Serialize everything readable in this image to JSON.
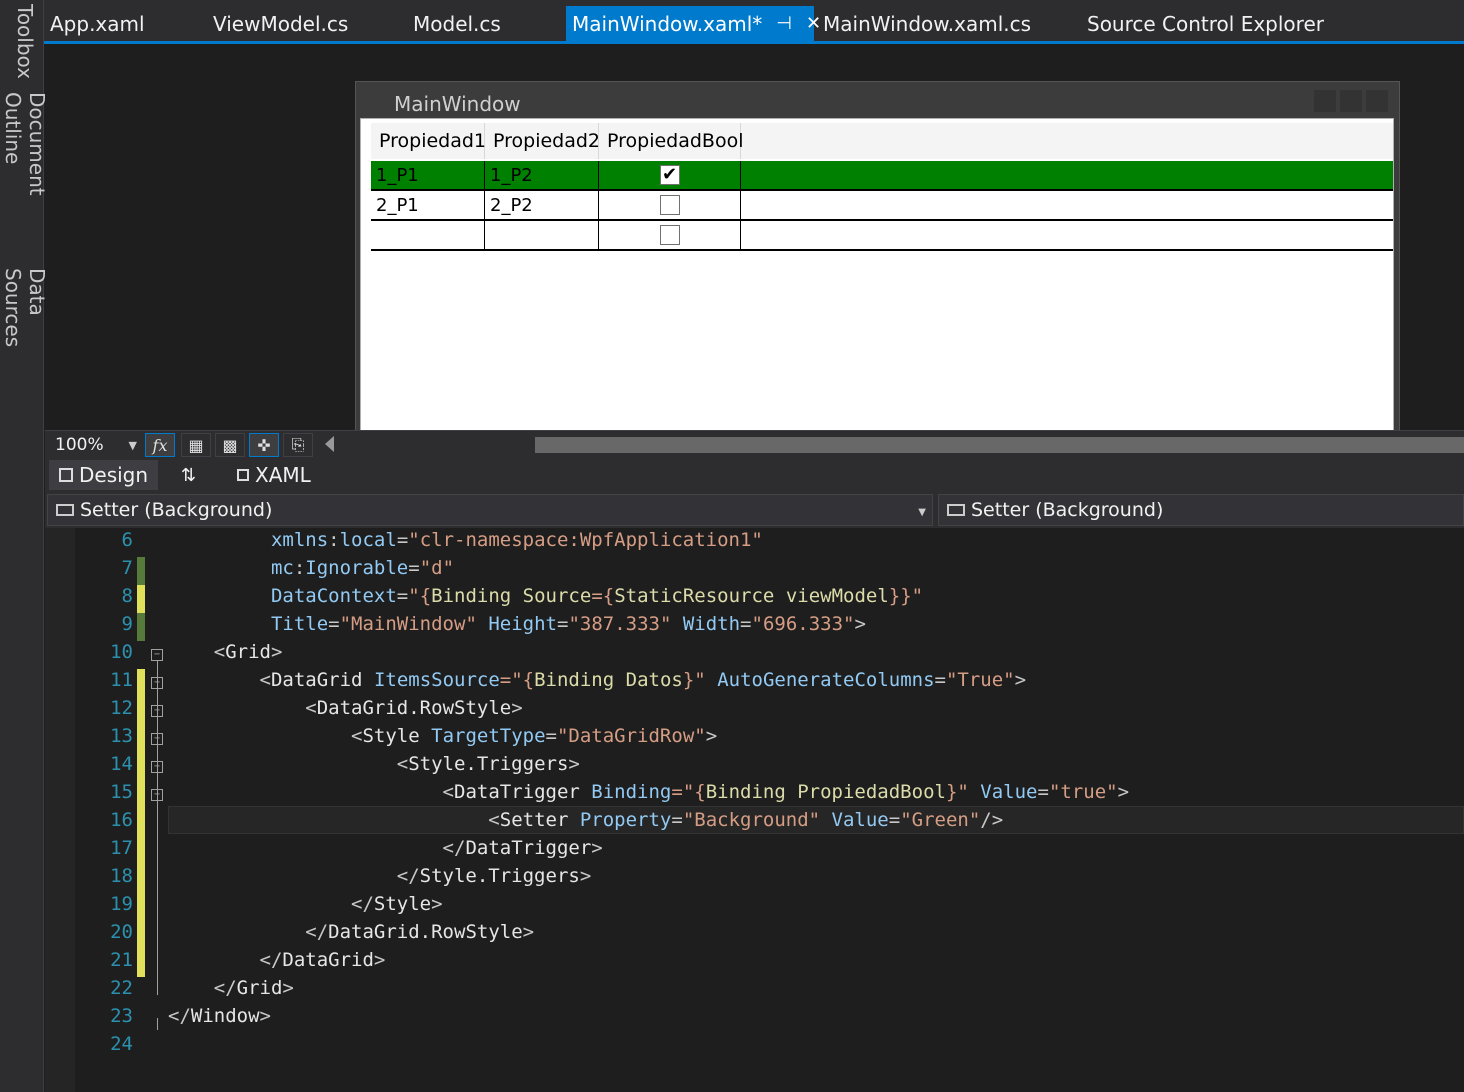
{
  "side_tabs": [
    "Toolbox",
    "Document Outline",
    "Data Sources"
  ],
  "doc_tabs": [
    {
      "label": "App.xaml"
    },
    {
      "label": "ViewModel.cs"
    },
    {
      "label": "Model.cs"
    },
    {
      "label": "MainWindow.xaml*",
      "active": true
    },
    {
      "label": "MainWindow.xaml.cs"
    },
    {
      "label": "Source Control Explorer"
    }
  ],
  "tab_pin_glyph": "⊣",
  "tab_close_glyph": "✕",
  "designer": {
    "window_title": "MainWindow",
    "grid": {
      "columns": [
        "Propiedad1",
        "Propiedad2",
        "PropiedadBool"
      ],
      "rows": [
        {
          "p1": "1_P1",
          "p2": "1_P2",
          "bool": true,
          "highlight_color": "#008000"
        },
        {
          "p1": "2_P1",
          "p2": "2_P2",
          "bool": false
        },
        {
          "p1": "",
          "p2": "",
          "bool": false
        }
      ]
    }
  },
  "toolbar": {
    "zoom": "100%",
    "fx_label": "fx"
  },
  "view_tabs": {
    "design": "Design",
    "swap_glyph": "⇅",
    "xaml": "XAML"
  },
  "nav": {
    "left": "Setter (Background)",
    "right": "Setter (Background)"
  },
  "code_lines": [
    {
      "n": "6"
    },
    {
      "n": "7"
    },
    {
      "n": "8"
    },
    {
      "n": "9"
    },
    {
      "n": "10"
    },
    {
      "n": "11"
    },
    {
      "n": "12"
    },
    {
      "n": "13"
    },
    {
      "n": "14"
    },
    {
      "n": "15"
    },
    {
      "n": "16"
    },
    {
      "n": "17"
    },
    {
      "n": "18"
    },
    {
      "n": "19"
    },
    {
      "n": "20"
    },
    {
      "n": "21"
    },
    {
      "n": "22"
    },
    {
      "n": "23"
    },
    {
      "n": "24"
    }
  ],
  "code": {
    "l6": {
      "attr": "xmlns",
      "sep": ":",
      "attr2": "local",
      "val": "\"clr-namespace:WpfApplication1\""
    },
    "l7": {
      "attr": "mc",
      "sep": ":",
      "attr2": "Ignorable",
      "val": "\"d\""
    },
    "l8": {
      "attr": "DataContext",
      "q1": "\"{",
      "kw": "Binding",
      "attr2": "Source",
      "q2": "={",
      "kw2": "StaticResource",
      "val": "viewModel",
      "q3": "}}\""
    },
    "l9": {
      "attr": "Title",
      "val": "\"MainWindow\"",
      "attr2": "Height",
      "val2": "\"387.333\"",
      "attr3": "Width",
      "val3": "\"696.333\"",
      "close": ">"
    },
    "l10": {
      "open": "<",
      "tag": "Grid",
      "close": ">"
    },
    "l11": {
      "open": "<",
      "tag": "DataGrid",
      "attr": "ItemsSource",
      "q1": "=\"{",
      "kw": "Binding",
      "val": "Datos",
      "q2": "}\"",
      "attr2": "AutoGenerateColumns",
      "val2": "\"True\"",
      "close": ">"
    },
    "l12": {
      "open": "<",
      "tag": "DataGrid.RowStyle",
      "close": ">"
    },
    "l13": {
      "open": "<",
      "tag": "Style",
      "attr": "TargetType",
      "val": "\"DataGridRow\"",
      "close": ">"
    },
    "l14": {
      "open": "<",
      "tag": "Style.Triggers",
      "close": ">"
    },
    "l15": {
      "open": "<",
      "tag": "DataTrigger",
      "attr": "Binding",
      "q1": "=\"{",
      "kw": "Binding",
      "val": "PropiedadBool",
      "q2": "}\"",
      "attr2": "Value",
      "val2": "\"true\"",
      "close": ">"
    },
    "l16": {
      "open": "<",
      "tag": "Setter",
      "attr": "Property",
      "val": "\"Background\"",
      "attr2": "Value",
      "val2": "\"Green\"",
      "close": "/>"
    },
    "l17": {
      "open": "</",
      "tag": "DataTrigger",
      "close": ">"
    },
    "l18": {
      "open": "</",
      "tag": "Style.Triggers",
      "close": ">"
    },
    "l19": {
      "open": "</",
      "tag": "Style",
      "close": ">"
    },
    "l20": {
      "open": "</",
      "tag": "DataGrid.RowStyle",
      "close": ">"
    },
    "l21": {
      "open": "</",
      "tag": "DataGrid",
      "close": ">"
    },
    "l22": {
      "open": "</",
      "tag": "Grid",
      "close": ">"
    },
    "l23": {
      "open": "</",
      "tag": "Window",
      "close": ">"
    }
  },
  "colors": {
    "accent": "#007acc",
    "row_highlight": "#008000",
    "line_number": "#2b91af",
    "change_marker_saved": "#557a3a",
    "change_marker_unsaved": "#e0e05a"
  }
}
